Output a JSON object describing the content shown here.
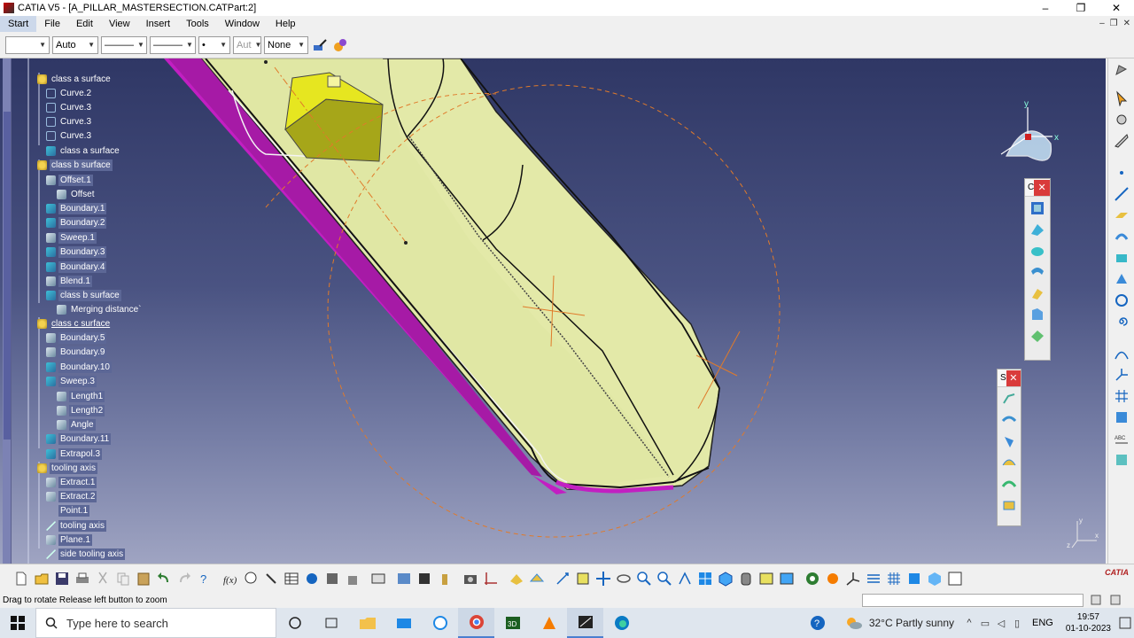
{
  "window": {
    "title": "CATIA V5 - [A_PILLAR_MASTERSECTION.CATPart:2]",
    "buttons": [
      "–",
      "❐",
      "✕"
    ]
  },
  "menubar": {
    "items": [
      "Start",
      "File",
      "Edit",
      "View",
      "Insert",
      "Tools",
      "Window",
      "Help"
    ],
    "mdi_buttons": [
      "–",
      "❐",
      "✕"
    ]
  },
  "propbar": {
    "color_value": "",
    "transparency_value": "Auto",
    "linetype_value": "———",
    "linewidth_value": "———",
    "point_symbol_value": "•",
    "layer_value": "Aut",
    "layer2_value": "None"
  },
  "tree": {
    "nodes": [
      {
        "label": "class a surface",
        "icon": "set-icon"
      },
      {
        "label": "Curve.2",
        "icon": "curve-icon"
      },
      {
        "label": "Curve.3",
        "icon": "curve-icon"
      },
      {
        "label": "Curve.3",
        "icon": "curve-icon"
      },
      {
        "label": "Curve.3",
        "icon": "curve-icon"
      },
      {
        "label": "class a surface",
        "icon": "surface-icon"
      },
      {
        "label": "class b surface",
        "icon": "set-icon"
      },
      {
        "label": "Offset.1",
        "icon": "param-icon"
      },
      {
        "label": "Offset",
        "icon": "param-icon"
      },
      {
        "label": "Boundary.1",
        "icon": "surface-icon"
      },
      {
        "label": "Boundary.2",
        "icon": "surface-icon"
      },
      {
        "label": "Sweep.1",
        "icon": "param-icon"
      },
      {
        "label": "Boundary.3",
        "icon": "surface-icon"
      },
      {
        "label": "Boundary.4",
        "icon": "surface-icon"
      },
      {
        "label": "Blend.1",
        "icon": "param-icon"
      },
      {
        "label": "class b surface",
        "icon": "surface-icon"
      },
      {
        "label": "Merging distance`",
        "icon": "param-icon"
      },
      {
        "label": "class c surface",
        "icon": "set-icon"
      },
      {
        "label": "Boundary.5",
        "icon": "param-icon"
      },
      {
        "label": "Boundary.9",
        "icon": "param-icon"
      },
      {
        "label": "Boundary.10",
        "icon": "surface-icon"
      },
      {
        "label": "Sweep.3",
        "icon": "surface-icon"
      },
      {
        "label": "Length1",
        "icon": "param-icon"
      },
      {
        "label": "Length2",
        "icon": "param-icon"
      },
      {
        "label": "Angle",
        "icon": "param-icon"
      },
      {
        "label": "Boundary.11",
        "icon": "surface-icon"
      },
      {
        "label": "Extrapol.3",
        "icon": "surface-icon"
      },
      {
        "label": "tooling axis",
        "icon": "set-icon"
      },
      {
        "label": "Extract.1",
        "icon": "param-icon"
      },
      {
        "label": "Extract.2",
        "icon": "param-icon"
      },
      {
        "label": "Point.1",
        "icon": "point-icon"
      },
      {
        "label": "tooling axis",
        "icon": "line-icon"
      },
      {
        "label": "Plane.1",
        "icon": "plane-icon"
      },
      {
        "label": "side tooling axis",
        "icon": "line-icon"
      }
    ]
  },
  "floating_toolbars": {
    "c_title": "C",
    "s_title": "S"
  },
  "compass": {
    "x_label": "x",
    "y_label": "y"
  },
  "axis_indicator": {
    "x_label": "x",
    "y_label": "y",
    "z_label": "z"
  },
  "bottom_logo": "CATIA",
  "status": {
    "message": "Drag to rotate  Release left button to zoom"
  },
  "taskbar": {
    "search_placeholder": "Type here to search",
    "weather": "32°C  Partly sunny",
    "language": "ENG",
    "time": "19:57",
    "date": "01-10-2023"
  },
  "colors": {
    "viewport_top": "#2f3765",
    "part_surface": "#e3e9a8",
    "magenta_edge": "#c21fc2",
    "yellow_block": "#e6e620",
    "orange_construction": "#e07a2a",
    "tree_text": "#ffffff"
  }
}
